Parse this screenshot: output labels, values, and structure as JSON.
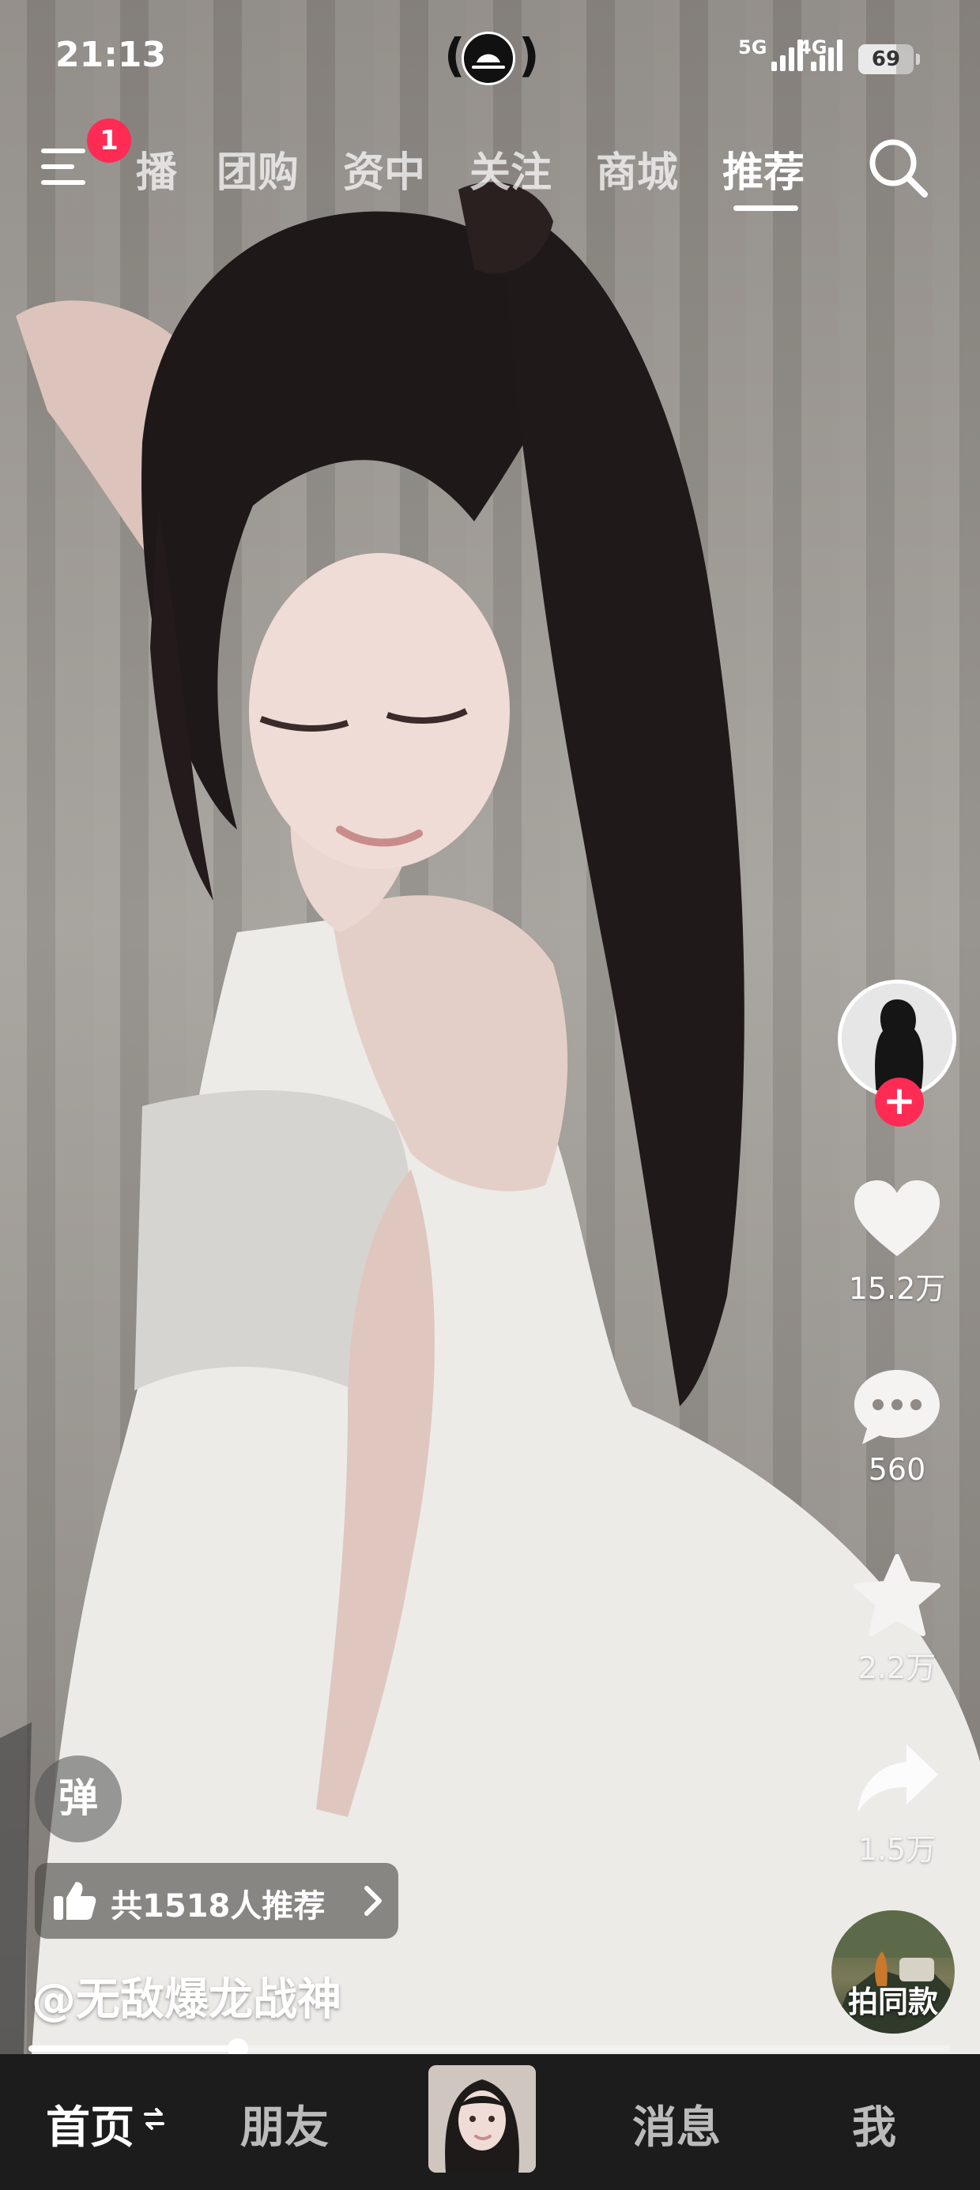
{
  "status_bar": {
    "time": "21:13",
    "signal_1": "5G",
    "signal_2": "4G",
    "battery": "69",
    "battery_level": 0.69
  },
  "top_nav": {
    "menu_badge": "1",
    "tabs": [
      {
        "label": "播",
        "active": false
      },
      {
        "label": "团购",
        "active": false
      },
      {
        "label": "资中",
        "active": false
      },
      {
        "label": "关注",
        "active": false
      },
      {
        "label": "商城",
        "active": false
      },
      {
        "label": "推荐",
        "active": true
      }
    ]
  },
  "rail": {
    "likes": "15.2万",
    "comments": "560",
    "favorites": "2.2万",
    "shares": "1.5万",
    "same_style_label": "拍同款"
  },
  "overlay": {
    "danmu_label": "弹",
    "recommend_text": "共1518人推荐",
    "author": "@无敌爆龙战神"
  },
  "progress": {
    "value": 0.227
  },
  "bottom_nav": {
    "home": "首页",
    "friends": "朋友",
    "messages": "消息",
    "me": "我"
  },
  "colors": {
    "accent": "#fe2c55",
    "nav_bg": "#1c1c1c"
  },
  "icons": [
    "menu-icon",
    "search-icon",
    "heart-icon",
    "comment-icon",
    "star-icon",
    "share-icon",
    "thumbs-up-icon",
    "chevron-right-icon",
    "swap-icon"
  ]
}
